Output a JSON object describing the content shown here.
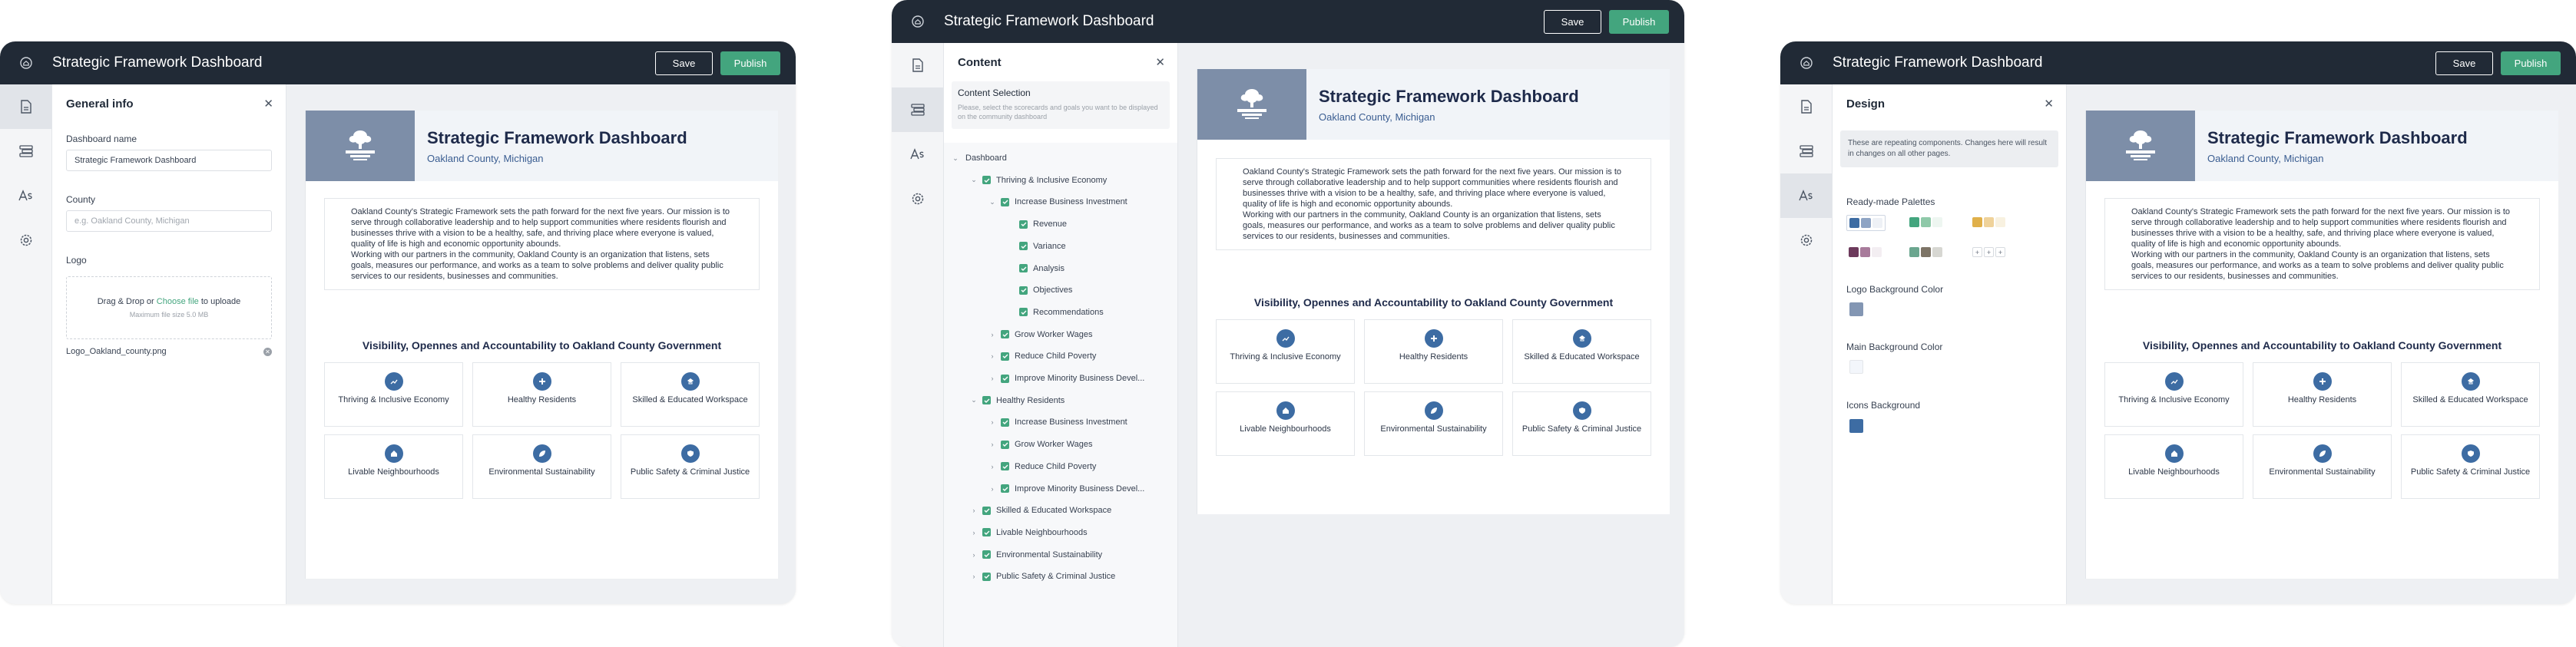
{
  "app": {
    "title": "Strategic Framework Dashboard",
    "save_label": "Save",
    "publish_label": "Publish"
  },
  "colors": {
    "topbar": "#212a36",
    "accent": "#43a57e",
    "brand_navy": "#1e2a4a",
    "icon_blue": "#3d6ca3",
    "logo_bg": "#7d8ea8"
  },
  "rail_icons": [
    "document-icon",
    "layers-icon",
    "text-style-icon",
    "gear-icon"
  ],
  "general": {
    "title": "General info",
    "dashboard_name_label": "Dashboard name",
    "dashboard_name_value": "Strategic Framework Dashboard",
    "county_label": "County",
    "county_placeholder": "e.g. Oakland County, Michigan",
    "logo_label": "Logo",
    "drop_text_pre": "Drag & Drop or ",
    "drop_link": "Choose file",
    "drop_text_post": " to uploade",
    "drop_sub": "Maximum file size 5.0 MB",
    "file_name": "Logo_Oakland_county.png"
  },
  "content": {
    "title": "Content",
    "section_title": "Content Selection",
    "section_desc": "Please, select the scorecards and goals you want to be displayed on the community dashboard",
    "tree": [
      {
        "label": "Dashboard",
        "level": 0,
        "chevron": "down",
        "checkbox": false
      },
      {
        "label": "Thriving & Inclusive Economy",
        "level": 1,
        "chevron": "down",
        "checkbox": true
      },
      {
        "label": "Increase Business Investment",
        "level": 2,
        "chevron": "down",
        "checkbox": true
      },
      {
        "label": "Revenue",
        "level": 3,
        "chevron": "",
        "checkbox": true
      },
      {
        "label": "Variance",
        "level": 3,
        "chevron": "",
        "checkbox": true
      },
      {
        "label": "Analysis",
        "level": 3,
        "chevron": "",
        "checkbox": true
      },
      {
        "label": "Objectives",
        "level": 3,
        "chevron": "",
        "checkbox": true
      },
      {
        "label": "Recommendations",
        "level": 3,
        "chevron": "",
        "checkbox": true
      },
      {
        "label": "Grow Worker Wages",
        "level": 2,
        "chevron": "right",
        "checkbox": true
      },
      {
        "label": "Reduce Child Poverty",
        "level": 2,
        "chevron": "right",
        "checkbox": true
      },
      {
        "label": "Improve Minority Business Devel...",
        "level": 2,
        "chevron": "right",
        "checkbox": true
      },
      {
        "label": "Healthy Residents",
        "level": 1,
        "chevron": "down",
        "checkbox": true
      },
      {
        "label": "Increase Business Investment",
        "level": 2,
        "chevron": "right",
        "checkbox": true
      },
      {
        "label": "Grow Worker Wages",
        "level": 2,
        "chevron": "right",
        "checkbox": true
      },
      {
        "label": "Reduce Child Poverty",
        "level": 2,
        "chevron": "right",
        "checkbox": true
      },
      {
        "label": "Improve Minority Business Devel...",
        "level": 2,
        "chevron": "right",
        "checkbox": true
      },
      {
        "label": "Skilled & Educated Workspace",
        "level": 1,
        "chevron": "right",
        "checkbox": true
      },
      {
        "label": "Livable Neighbourhoods",
        "level": 1,
        "chevron": "right",
        "checkbox": true
      },
      {
        "label": "Environmental Sustainability",
        "level": 1,
        "chevron": "right",
        "checkbox": true
      },
      {
        "label": "Public Safety & Criminal Justice",
        "level": 1,
        "chevron": "right",
        "checkbox": true
      }
    ]
  },
  "design": {
    "title": "Design",
    "info": "These are repeating components. Changes here will result in changes on all other pages.",
    "palettes_label": "Ready-made Palettes",
    "palettes": [
      [
        "#3d6ca3",
        "#8ea4c4",
        "#eef1f6"
      ],
      [
        "#43a57e",
        "#8fc9a9",
        "#eef6f1"
      ],
      [
        "#e0b04a",
        "#efd29a",
        "#f8f1e0"
      ],
      [
        "#6d3a5c",
        "#a87b9b",
        "#f3eef2"
      ],
      [
        "#6ba68f",
        "#7d7466",
        "#d7d7d2"
      ]
    ],
    "custom_palette_glyph": "+",
    "logo_bg_label": "Logo Background Color",
    "logo_bg_color": "#8396b3",
    "main_bg_label": "Main Background Color",
    "main_bg_color": "#f3f6fb",
    "icons_bg_label": "Icons Background",
    "icons_bg_color": "#3d6ca3"
  },
  "dashboard": {
    "logo_text": "OAKLAND COUNTY MICHIGAN",
    "title": "Strategic Framework Dashboard",
    "subtitle": "Oakland County, Michigan",
    "intro_1": "Oakland County's Strategic Framework sets the path forward for the next five years. Our mission is to serve through collaborative leadership and to help support communities where residents flourish and businesses thrive with a vision to be a healthy, safe, and thriving place where everyone is valued, quality of life is high and economic opportunity abounds.",
    "intro_2": "Working with our partners in the community, Oakland County is an organization that listens, sets goals, measures our performance, and works as a team to solve problems and deliver quality public services to our residents, businesses and communities.",
    "vis_title": "Visibility, Opennes and Accountability to Oakland County Government",
    "cards": [
      {
        "label": "Thriving & Inclusive Economy",
        "icon": "economy-icon"
      },
      {
        "label": "Healthy Residents",
        "icon": "health-icon"
      },
      {
        "label": "Skilled & Educated Workspace",
        "icon": "education-icon"
      },
      {
        "label": "Livable Neighbourhoods",
        "icon": "home-icon"
      },
      {
        "label": "Environmental Sustainability",
        "icon": "leaf-icon"
      },
      {
        "label": "Public Safety & Criminal Justice",
        "icon": "shield-icon"
      }
    ]
  }
}
